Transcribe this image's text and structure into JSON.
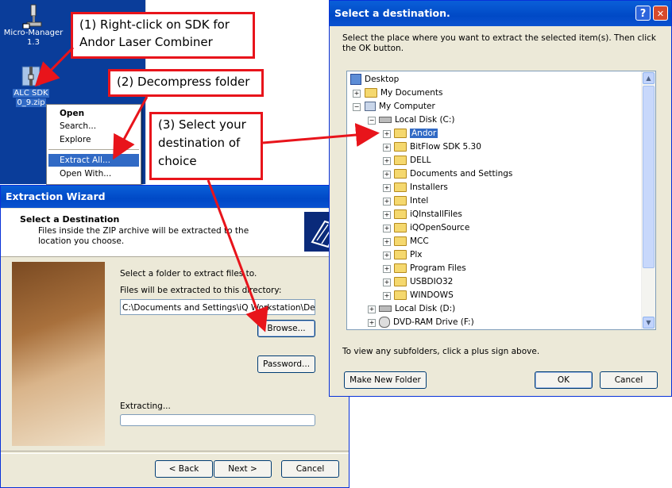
{
  "desktop": {
    "icons": [
      {
        "label_line1": "Micro-Manager",
        "label_line2": "1.3"
      },
      {
        "label_line1": "ALC SDK",
        "label_line2": "0_9.zip"
      }
    ]
  },
  "context_menu": {
    "items": [
      "Open",
      "Search...",
      "Explore",
      "Extract All...",
      "Open With..."
    ]
  },
  "callouts": {
    "step1_line1": "(1) Right-click on SDK for",
    "step1_line2": "Andor Laser Combiner",
    "step2": "(2) Decompress folder",
    "step3_line1": "(3) Select your",
    "step3_line2": "destination of",
    "step3_line3": "choice"
  },
  "wizard": {
    "title": "Extraction Wizard",
    "heading": "Select a Destination",
    "description": "Files inside the ZIP archive will be extracted to the location you choose.",
    "select_label": "Select a folder to extract files to.",
    "directory_label": "Files will be extracted to this directory:",
    "directory_value": "C:\\Documents and Settings\\iQ Workstation\\Deskt",
    "browse_label": "Browse...",
    "password_label": "Password...",
    "extracting_label": "Extracting...",
    "back_label": "< Back",
    "next_label": "Next >",
    "cancel_label": "Cancel",
    "progress": 0
  },
  "dialog": {
    "title": "Select a destination.",
    "help_glyph": "?",
    "close_glyph": "✕",
    "instruction": "Select the place where you want to extract the selected item(s).  Then click the OK button.",
    "hint": "To view any subfolders, click a plus sign above.",
    "make_folder_label": "Make New Folder",
    "ok_label": "OK",
    "cancel_label": "Cancel",
    "tree": {
      "desktop": "Desktop",
      "my_documents": "My Documents",
      "my_computer": "My Computer",
      "local_disk_c": "Local Disk (C:)",
      "folders": [
        "Andor",
        "BitFlow SDK 5.30",
        "DELL",
        "Documents and Settings",
        "Installers",
        "Intel",
        "iQInstallFiles",
        "iQOpenSource",
        "MCC",
        "Plx",
        "Program Files",
        "USBDIO32",
        "WINDOWS"
      ],
      "local_disk_d": "Local Disk (D:)",
      "dvd_drive": "DVD-RAM Drive (F:)"
    }
  },
  "colors": {
    "callout_red": "#e8141b",
    "title_blue": "#0049c6",
    "selection_blue": "#316ac5"
  }
}
